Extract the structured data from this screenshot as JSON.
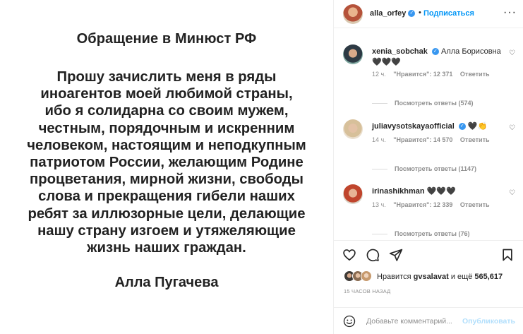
{
  "post": {
    "heading": "Обращение в Минюст РФ",
    "body_lines": [
      "Прошу зачислить меня в ряды",
      "иноагентов моей любимой страны,",
      "ибо я солидарна со своим мужем,",
      "честным, порядочным и искренним",
      "человеком, настоящим и неподкупным",
      "патриотом России, желающим Родине",
      "процветания, мирной жизни, свободы",
      "слова и прекращения гибели наших",
      "ребят за иллюзорные цели, делающие",
      "нашу страну изгоем и утяжеляющие",
      "жизнь наших граждан."
    ],
    "signature": "Алла Пугачева"
  },
  "header": {
    "username": "alla_orfey",
    "dot": "•",
    "follow_label": "Подписаться",
    "more_label": "···"
  },
  "comments": [
    {
      "username": "xenia_sobchak",
      "text": "Алла Борисовна",
      "emoji_line": "🖤🖤🖤",
      "time": "12 ч.",
      "likes": "\"Нравится\": 12 371",
      "reply": "Ответить",
      "replies": "Посмотреть ответы (574)"
    },
    {
      "username": "juliavysotskayaofficial",
      "text": "🖤👏",
      "emoji_line": "",
      "time": "14 ч.",
      "likes": "\"Нравится\": 14 570",
      "reply": "Ответить",
      "replies": "Посмотреть ответы (1147)"
    },
    {
      "username": "irinashikhman",
      "text": "🖤🖤🖤",
      "emoji_line": "",
      "time": "13 ч.",
      "likes": "\"Нравится\": 12 339",
      "reply": "Ответить",
      "replies": "Посмотреть ответы (76)"
    }
  ],
  "likes": {
    "prefix": "Нравится",
    "user": "gvsalavat",
    "middle": "и ещё",
    "count": "565,617"
  },
  "time_ago": "15 ЧАСОВ НАЗАД",
  "add_comment": {
    "placeholder": "Добавьте комментарий...",
    "publish_label": "Опубликовать"
  },
  "colors": {
    "accent": "#0095f6",
    "publish_disabled": "#b2dffc",
    "muted": "#8e8e8e",
    "text": "#262626"
  }
}
